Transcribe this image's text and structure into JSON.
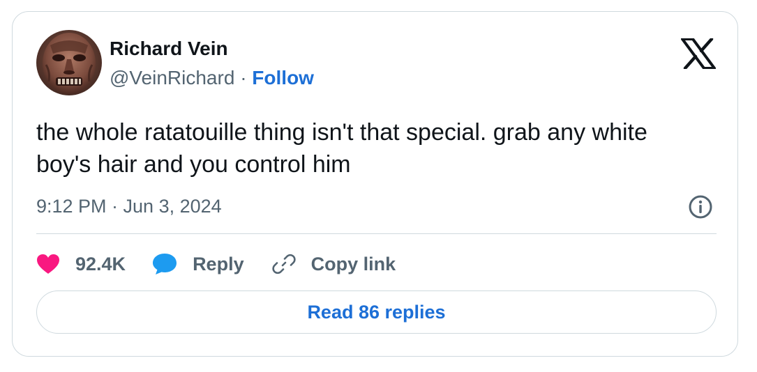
{
  "author": {
    "display_name": "Richard Vein",
    "handle": "@VeinRichard",
    "separator": "·",
    "follow_label": "Follow"
  },
  "platform_logo": "x-logo-icon",
  "tweet": {
    "text": "the whole ratatouille thing isn't that special. grab any white boy's hair and you control him",
    "timestamp": "9:12 PM · Jun 3, 2024"
  },
  "actions": {
    "likes_count": "92.4K",
    "reply_label": "Reply",
    "copy_link_label": "Copy link"
  },
  "read_replies_label": "Read 86 replies",
  "icons": {
    "like": "heart-icon",
    "reply": "speech-bubble-icon",
    "copy_link": "link-icon",
    "info": "info-icon"
  },
  "colors": {
    "like": "#f91880",
    "reply": "#1d9bf0",
    "link_text": "#1d6fd6",
    "secondary_text": "#536471",
    "border": "#cfd9de"
  }
}
